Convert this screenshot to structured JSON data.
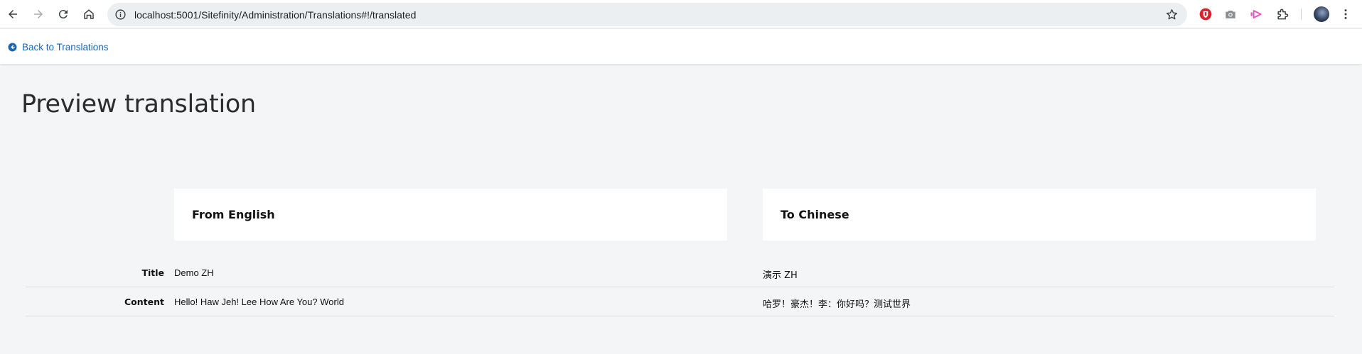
{
  "browser": {
    "url": "localhost:5001/Sitefinity/Administration/Translations#!/translated",
    "icons": [
      "back-arrow-icon",
      "forward-arrow-icon",
      "reload-icon",
      "home-icon",
      "info-icon",
      "bookmark-star-icon",
      "extension-red-shield-icon",
      "camera-icon",
      "extension-pink-arrow-icon",
      "puzzle-extensions-icon",
      "profile-avatar",
      "kebab-menu-icon"
    ]
  },
  "topbar": {
    "back_link": "Back to Translations"
  },
  "page": {
    "title": "Preview translation",
    "from_label": "From English",
    "to_label": "To Chinese"
  },
  "rows": [
    {
      "label": "Title",
      "source": "Demo ZH",
      "translation": "演示 ZH"
    },
    {
      "label": "Content",
      "source": "Hello! Haw Jeh! Lee How Are You? World",
      "translation": "哈罗！豪杰！李：你好吗？测试世界"
    }
  ],
  "colors": {
    "link": "#1d66b5",
    "page_background": "#f4f5f7",
    "card_background": "#ffffff"
  }
}
